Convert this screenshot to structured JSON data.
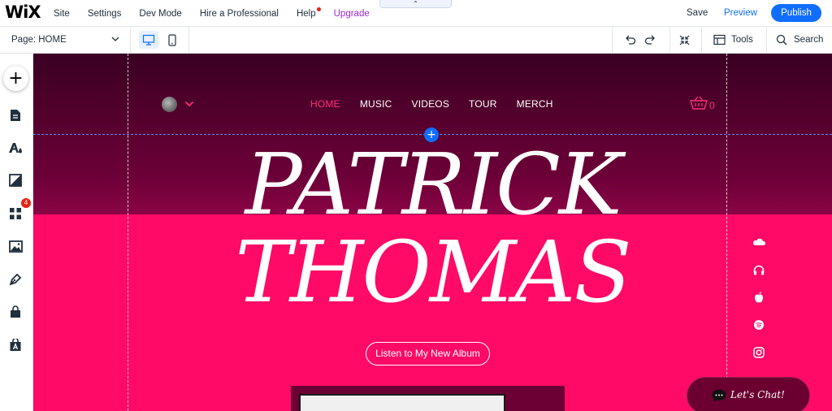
{
  "topbar": {
    "logo": "WiX",
    "menu": [
      "Site",
      "Settings",
      "Dev Mode",
      "Hire a Professional",
      "Help",
      "Upgrade"
    ],
    "save": "Save",
    "preview": "Preview",
    "publish": "Publish"
  },
  "toolbar": {
    "page_label": "Page: HOME",
    "tools": "Tools",
    "search": "Search"
  },
  "sidebar": {
    "add_label": "+",
    "badge_count": "4",
    "items": [
      "pages-icon",
      "design-icon",
      "background-icon",
      "apps-icon",
      "media-icon",
      "pen-icon",
      "store-icon",
      "fonts-icon"
    ]
  },
  "site": {
    "nav": [
      "HOME",
      "MUSIC",
      "VIDEOS",
      "TOUR",
      "MERCH"
    ],
    "active_nav": "HOME",
    "cart_count": "0",
    "hero_line1": "PATRICK",
    "hero_line2": "THOMAS",
    "cta": "Listen to My New Album",
    "social": [
      "soundcloud-icon",
      "headphones-icon",
      "apple-icon",
      "spotify-icon",
      "instagram-icon"
    ],
    "chat": "Let's Chat!"
  },
  "colors": {
    "brand_blue": "#116dff",
    "upgrade_purple": "#9a27d5",
    "site_pink": "#ff0a66",
    "accent_pink": "#ff2d7a"
  }
}
